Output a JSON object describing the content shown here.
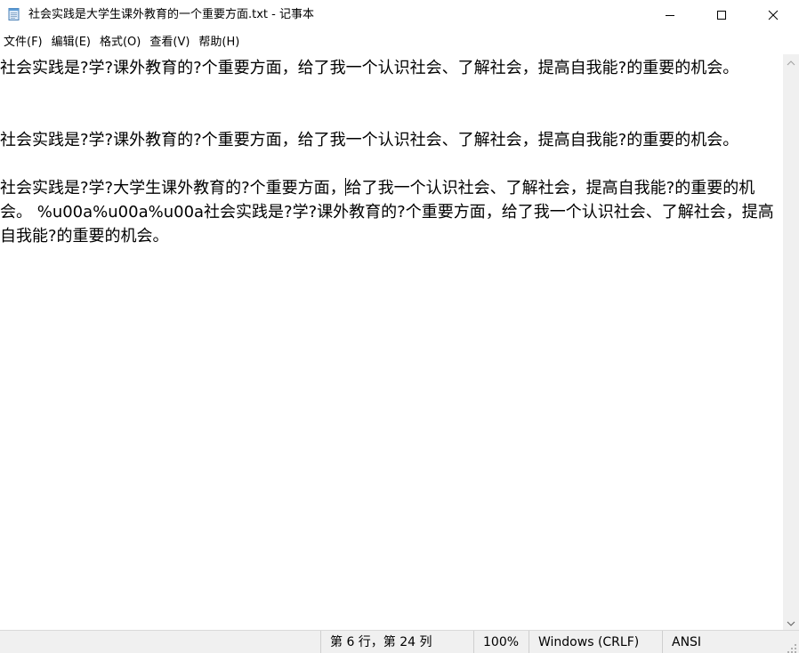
{
  "window": {
    "title": "社会实践是大学生课外教育的一个重要方面.txt - 记事本",
    "app_icon": "notepad-icon",
    "controls": {
      "minimize_icon": "minimize-icon",
      "maximize_icon": "maximize-icon",
      "close_icon": "close-icon"
    }
  },
  "menu": {
    "items": [
      {
        "label": "文件(F)"
      },
      {
        "label": "编辑(E)"
      },
      {
        "label": "格式(O)"
      },
      {
        "label": "查看(V)"
      },
      {
        "label": "帮助(H)"
      }
    ]
  },
  "editor": {
    "text_before_caret": "社会实践是?学?课外教育的?个重要方面，给了我一个认识社会、了解社会，提高自我能?的重要的机会。\n\n\n社会实践是?学?课外教育的?个重要方面，给了我一个认识社会、了解社会，提高自我能?的重要的机会。\n\n社会实践是?学?大学生课外教育的?个重要方面，",
    "text_after_caret": "给了我一个认识社会、了解社会，提高自我能?的重要的机会。 %u00a%u00a%u00a社会实践是?学?课外教育的?个重要方面，给了我一个认识社会、了解社会，提高自我能?的重要的机会。"
  },
  "scrollbar": {
    "up_icon": "scroll-up-arrow-icon",
    "down_icon": "scroll-down-arrow-icon"
  },
  "status": {
    "position": "第 6 行，第 24 列",
    "zoom": "100%",
    "line_ending": "Windows (CRLF)",
    "encoding": "ANSI"
  },
  "colors": {
    "background": "#ffffff",
    "statusbar": "#f0f0f0",
    "text": "#000000"
  }
}
